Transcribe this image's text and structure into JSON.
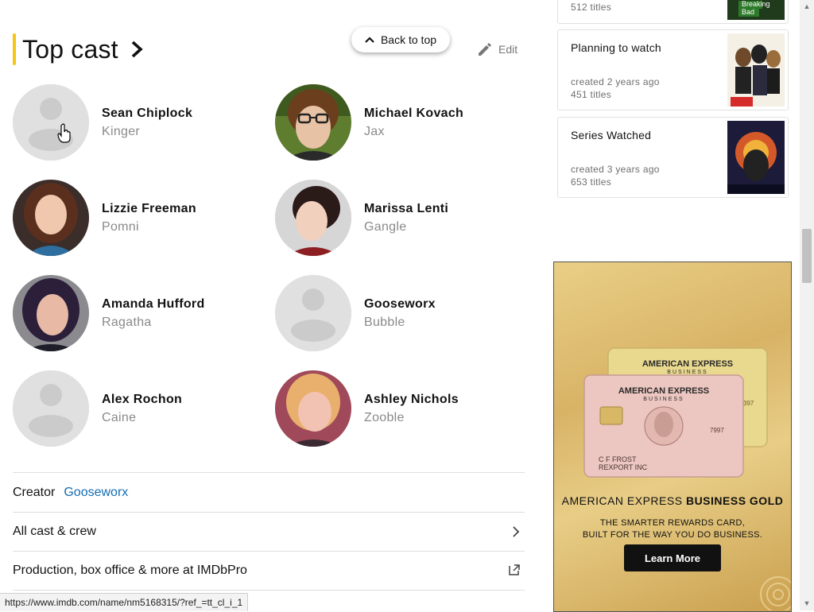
{
  "top_cast": {
    "title": "Top cast",
    "back_to_top": "Back to top",
    "edit": "Edit",
    "members": [
      {
        "name": "Sean Chiplock",
        "role": "Kinger"
      },
      {
        "name": "Michael Kovach",
        "role": "Jax"
      },
      {
        "name": "Lizzie Freeman",
        "role": "Pomni"
      },
      {
        "name": "Marissa Lenti",
        "role": "Gangle"
      },
      {
        "name": "Amanda Hufford",
        "role": "Ragatha"
      },
      {
        "name": "Gooseworx",
        "role": "Bubble"
      },
      {
        "name": "Alex Rochon",
        "role": "Caine"
      },
      {
        "name": "Ashley Nichols",
        "role": "Zooble"
      }
    ]
  },
  "creator": {
    "label": "Creator",
    "name": "Gooseworx"
  },
  "links": {
    "all_cast": "All cast & crew",
    "imdbpro": "Production, box office & more at IMDbPro"
  },
  "status_bar": {
    "url": "https://www.imdb.com/name/nm5168315/?ref_=tt_cl_i_1"
  },
  "lists": [
    {
      "title": "",
      "created": "",
      "count": "512 titles",
      "thumb_text": "Breaking Bad"
    },
    {
      "title": "Planning to watch",
      "created": "created 2 years ago",
      "count": "451 titles",
      "thumb_text": ""
    },
    {
      "title": "Series Watched",
      "created": "created 3 years ago",
      "count": "653 titles",
      "thumb_text": ""
    }
  ],
  "ad": {
    "card_brand": "AMERICAN EXPRESS",
    "card_sub": "BUSINESS",
    "card_holder": "C F FROST",
    "card_company": "REXPORT INC",
    "card_number_tail": "7997",
    "back_card_tail": "397",
    "headline_regular": "AMERICAN EXPRESS ",
    "headline_bold": "BUSINESS GOLD",
    "subline_1": "THE SMARTER REWARDS CARD,",
    "subline_2": "BUILT FOR THE WAY YOU DO BUSINESS.",
    "button": "Learn More"
  },
  "colors": {
    "accent": "#f5c518",
    "link": "#136cb2",
    "ad_button": "#111111"
  }
}
